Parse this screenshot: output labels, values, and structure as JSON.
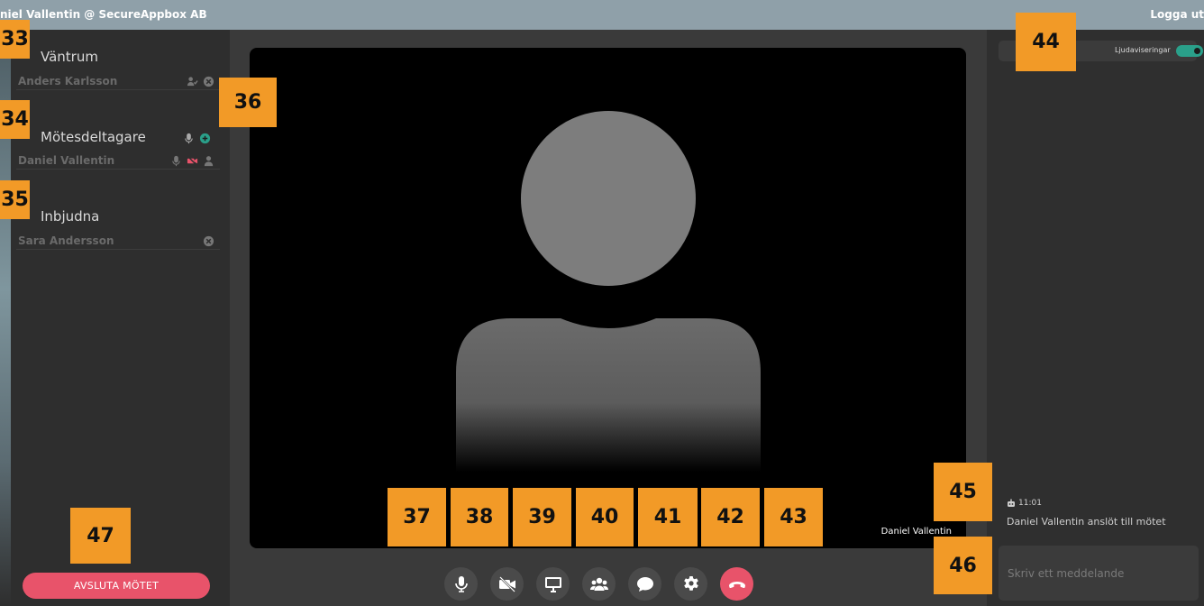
{
  "header": {
    "user": "niel Vallentin @ SecureAppbox AB",
    "logout": "Logga ut"
  },
  "sidebar": {
    "waiting_title": "Väntrum",
    "waiting": [
      {
        "name": "Anders Karlsson",
        "icons": [
          "admit-person-icon",
          "close-circle-icon"
        ]
      }
    ],
    "participants_title": "Mötesdeltagare",
    "participants": [
      {
        "name": "Daniel Vallentin",
        "icons": [
          "mic-icon",
          "camera-off-icon",
          "person-icon"
        ]
      }
    ],
    "invited_title": "Inbjudna",
    "invited": [
      {
        "name": "Sara Andersson",
        "icons": [
          "close-circle-icon"
        ]
      }
    ],
    "end_button": "AVSLUTA MÖTET"
  },
  "video": {
    "participant_name": "Daniel Vallentin"
  },
  "controls": [
    {
      "icon": "microphone-icon"
    },
    {
      "icon": "camera-off-icon"
    },
    {
      "icon": "screen-share-icon"
    },
    {
      "icon": "participants-icon"
    },
    {
      "icon": "chat-icon"
    },
    {
      "icon": "settings-icon"
    },
    {
      "icon": "hang-up-icon"
    }
  ],
  "right_panel": {
    "sound_notifications_label": "Ljudaviseringar",
    "sound_notifications_on": true,
    "messages": [
      {
        "time": "11:01",
        "text": "Daniel Vallentin anslöt till mötet"
      }
    ],
    "chat_placeholder": "Skriv ett meddelande"
  },
  "badges": [
    "33",
    "34",
    "35",
    "36",
    "37",
    "38",
    "39",
    "40",
    "41",
    "42",
    "43",
    "44",
    "45",
    "46",
    "47"
  ],
  "colors": {
    "topbar": "#8fa0a9",
    "accent_red": "#e8536a",
    "badge_orange": "#f29a27",
    "toggle_green": "#2aa08a"
  }
}
